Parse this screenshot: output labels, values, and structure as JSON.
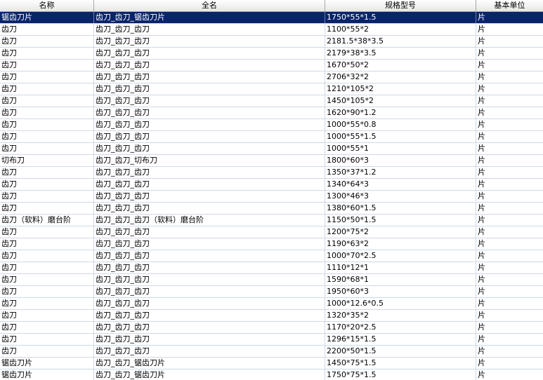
{
  "columns": [
    "名称",
    "全名",
    "规格型号",
    "基本单位"
  ],
  "selected_row": 0,
  "rows": [
    {
      "name": "锯齿刀片",
      "full_name": "齿刀_齿刀_锯齿刀片",
      "spec": "1750*55*1.5",
      "unit": "片"
    },
    {
      "name": "齿刀",
      "full_name": "齿刀_齿刀_齿刀",
      "spec": "1100*55*2",
      "unit": "片"
    },
    {
      "name": "齿刀",
      "full_name": "齿刀_齿刀_齿刀",
      "spec": "2181.5*38*3.5",
      "unit": "片"
    },
    {
      "name": "齿刀",
      "full_name": "齿刀_齿刀_齿刀",
      "spec": "2179*38*3.5",
      "unit": "片"
    },
    {
      "name": "齿刀",
      "full_name": "齿刀_齿刀_齿刀",
      "spec": "1670*50*2",
      "unit": "片"
    },
    {
      "name": "齿刀",
      "full_name": "齿刀_齿刀_齿刀",
      "spec": "2706*32*2",
      "unit": "片"
    },
    {
      "name": "齿刀",
      "full_name": "齿刀_齿刀_齿刀",
      "spec": "1210*105*2",
      "unit": "片"
    },
    {
      "name": "齿刀",
      "full_name": "齿刀_齿刀_齿刀",
      "spec": "1450*105*2",
      "unit": "片"
    },
    {
      "name": "齿刀",
      "full_name": "齿刀_齿刀_齿刀",
      "spec": "1620*90*1.2",
      "unit": "片"
    },
    {
      "name": "齿刀",
      "full_name": "齿刀_齿刀_齿刀",
      "spec": "1000*55*0.8",
      "unit": "片"
    },
    {
      "name": "齿刀",
      "full_name": "齿刀_齿刀_齿刀",
      "spec": "1000*55*1.5",
      "unit": "片"
    },
    {
      "name": "齿刀",
      "full_name": "齿刀_齿刀_齿刀",
      "spec": "1000*55*1",
      "unit": "片"
    },
    {
      "name": "切布刀",
      "full_name": "齿刀_齿刀_切布刀",
      "spec": "1800*60*3",
      "unit": "片"
    },
    {
      "name": "齿刀",
      "full_name": "齿刀_齿刀_齿刀",
      "spec": "1350*37*1.2",
      "unit": "片"
    },
    {
      "name": "齿刀",
      "full_name": "齿刀_齿刀_齿刀",
      "spec": "1340*64*3",
      "unit": "片"
    },
    {
      "name": "齿刀",
      "full_name": "齿刀_齿刀_齿刀",
      "spec": "1300*46*3",
      "unit": "片"
    },
    {
      "name": "齿刀",
      "full_name": "齿刀_齿刀_齿刀",
      "spec": "1380*60*1.5",
      "unit": "片"
    },
    {
      "name": "齿刀（软料）磨台阶",
      "full_name": "齿刀_齿刀_齿刀（软料）磨台阶",
      "spec": "1150*50*1.5",
      "unit": "片"
    },
    {
      "name": "齿刀",
      "full_name": "齿刀_齿刀_齿刀",
      "spec": "1200*75*2",
      "unit": "片"
    },
    {
      "name": "齿刀",
      "full_name": "齿刀_齿刀_齿刀",
      "spec": "1190*63*2",
      "unit": "片"
    },
    {
      "name": "齿刀",
      "full_name": "齿刀_齿刀_齿刀",
      "spec": "1000*70*2.5",
      "unit": "片"
    },
    {
      "name": "齿刀",
      "full_name": "齿刀_齿刀_齿刀",
      "spec": "1110*12*1",
      "unit": "片"
    },
    {
      "name": "齿刀",
      "full_name": "齿刀_齿刀_齿刀",
      "spec": "1590*68*1",
      "unit": "片"
    },
    {
      "name": "齿刀",
      "full_name": "齿刀_齿刀_齿刀",
      "spec": "1950*60*3",
      "unit": "片"
    },
    {
      "name": "齿刀",
      "full_name": "齿刀_齿刀_齿刀",
      "spec": "1000*12.6*0.5",
      "unit": "片"
    },
    {
      "name": "齿刀",
      "full_name": "齿刀_齿刀_齿刀",
      "spec": "1320*35*2",
      "unit": "片"
    },
    {
      "name": "齿刀",
      "full_name": "齿刀_齿刀_齿刀",
      "spec": "1170*20*2.5",
      "unit": "片"
    },
    {
      "name": "齿刀",
      "full_name": "齿刀_齿刀_齿刀",
      "spec": "1296*15*1.5",
      "unit": "片"
    },
    {
      "name": "齿刀",
      "full_name": "齿刀_齿刀_齿刀",
      "spec": "2200*50*1.5",
      "unit": "片"
    },
    {
      "name": "锯齿刀片",
      "full_name": "齿刀_齿刀_锯齿刀片",
      "spec": "1450*75*1.5",
      "unit": "片"
    },
    {
      "name": "锯齿刀片",
      "full_name": "齿刀_齿刀_锯齿刀片",
      "spec": "1750*75*1.5",
      "unit": "片"
    }
  ]
}
